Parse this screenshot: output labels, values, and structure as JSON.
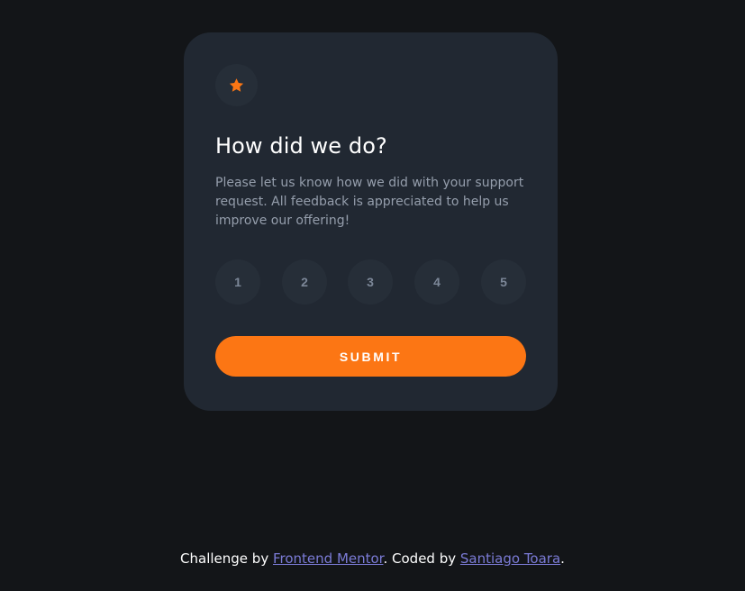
{
  "colors": {
    "background": "#131518",
    "card": "#212832",
    "circle": "#262e38",
    "accent": "#fc7614",
    "muted_text": "#959eac",
    "rating_text": "#7c8798",
    "link": "#7b7bd6"
  },
  "card": {
    "icon": "star-icon",
    "title": "How did we do?",
    "description": "Please let us know how we did with your support request. All feedback is appreciated to help us improve our offering!",
    "ratings": [
      "1",
      "2",
      "3",
      "4",
      "5"
    ],
    "submit_label": "SUBMIT"
  },
  "attribution": {
    "prefix": "Challenge by ",
    "link1": "Frontend Mentor",
    "middle": ". Coded by ",
    "link2": "Santiago Toara",
    "suffix": "."
  }
}
